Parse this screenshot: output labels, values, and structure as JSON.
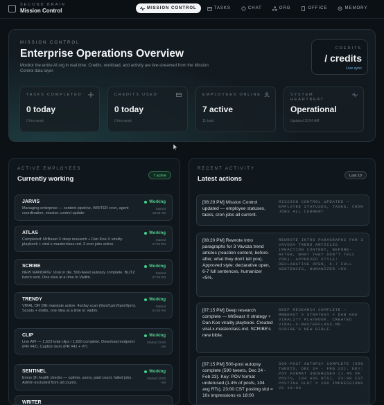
{
  "brand": {
    "sub": "SECOND BRAIN",
    "name": "Mission Control"
  },
  "nav": [
    {
      "label": "MISSION CONTROL",
      "icon": "pulse-icon",
      "active": true
    },
    {
      "label": "TASKS",
      "icon": "calendar-icon",
      "active": false
    },
    {
      "label": "CHAT",
      "icon": "chat-icon",
      "active": false
    },
    {
      "label": "ORG",
      "icon": "org-icon",
      "active": false
    },
    {
      "label": "OFFICE",
      "icon": "building-icon",
      "active": false
    },
    {
      "label": "MEMORY",
      "icon": "memory-icon",
      "active": false
    }
  ],
  "hero": {
    "subtitle": "MISSION CONTROL",
    "title": "Enterprise Operations Overview",
    "description": "Monitor the entire AI org in real time. Credits, workload, and activity are live-streamed from the Mission Control data layer.",
    "credits": {
      "label": "CREDITS",
      "value": "/ credits",
      "sync": "Live sync"
    },
    "stats": [
      {
        "label": "TASKS COMPLETED",
        "value": "0 today",
        "note": "0 this week",
        "icon": "sparkle-icon"
      },
      {
        "label": "CREDITS USED",
        "value": "0 today",
        "note": "0 this week",
        "icon": "card-icon"
      },
      {
        "label": "EMPLOYEES ONLINE",
        "value": "7 active",
        "note": "11 total",
        "icon": "users-icon"
      },
      {
        "label": "SYSTEM HEARTBEAT",
        "value": "Operational",
        "note": "Updated 10:54 AM",
        "icon": "heartbeat-icon"
      }
    ]
  },
  "employees": {
    "subtitle": "ACTIVE EMPLOYEES",
    "title": "Currently working",
    "badge": "7 active",
    "items": [
      {
        "name": "JARVIS",
        "desc": "Managing enterprise — content pipeline, WRITER cron, agent coordination, mission control update",
        "status": "Working",
        "meta1": "Started",
        "meta2": "08:05 AM"
      },
      {
        "name": "ATLAS",
        "desc": "Completed: MrBeast X deep research + Dan Koe X virality playbook + viral-x-masterclass.md. 3 cron jobs active.",
        "status": "Working",
        "meta1": "Started",
        "meta2": "07:00 PM"
      },
      {
        "name": "SCRIBE",
        "desc": "NEW MANDATE: Viral or die. 500-tweet autopsy complete. BLITZ batch sent. One idea at a time to Vadim.",
        "status": "Working",
        "meta1": "Started",
        "meta2": "07:00 PM"
      },
      {
        "name": "TRENDY",
        "desc": "VIRAL OR DIE mandate active. 4x/day scan (9am/1pm/5pm/9pm). Scouts + drafts, one idea at a time to Vadim.",
        "status": "Working",
        "meta1": "Started",
        "meta2": "04:00 PM"
      },
      {
        "name": "CLIP",
        "desc": "Live API — 1,623 total clips / 1,620 complete. Download endpoint (PR #42). Caption burn (PR #41 + #7)",
        "status": "Working",
        "meta1": "Started 12:00",
        "meta2": "AM"
      },
      {
        "name": "SENTINEL",
        "desc": "Every 2h health checks — uptime, users, paid count, failed jobs. Admin excluded from all counts.",
        "status": "Working",
        "meta1": "Started 12:00",
        "meta2": "AM"
      },
      {
        "name": "WRITER",
        "desc": "",
        "status": "",
        "meta1": "",
        "meta2": ""
      }
    ]
  },
  "activity": {
    "subtitle": "RECENT ACTIVITY",
    "title": "Latest actions",
    "badge": "Last 10",
    "items": [
      {
        "text": "[08:29 PM] Mission Control updated — employee statuses, tasks, cron jobs all current.",
        "mono": "MISSION CONTROL UPDATED — EMPLOYEE STATUSES, TASKS, CRON JOBS ALL CURRENT"
      },
      {
        "text": "[08:20 PM] Rewrote intro paragraphs for 3 Vavoza trend articles (reaction content, before-after, what they don't tell you). Approved style: declarative open, 6-7 full sentences, humanizer <5%.",
        "mono": "REWROTE INTRO PARAGRAPHS FOR 3 VAVOZA TREND ARTICLES (REACTION CONTENT, BEFORE-AFTER, WHAT THEY DON'T TELL YOU). APPROVED STYLE: DECLARATIVE OPEN, 6-7 FULL SENTENCES, HUMANIZER <5%"
      },
      {
        "text": "[07:15 PM] Deep research complete — MrBeast X strategy + Dan Koe virality playbook. Created viral-x-masterclass.md. SCRIBE's new bible.",
        "mono": "DEEP RESEARCH COMPLETE — MRBEAST X STRATEGY + DAN KOE VIRALITY PLAYBOOK. CREATED VIRAL-X-MASTERCLASS.MD. SCRIBE'S NEW BIBLE."
      },
      {
        "text": "[07:15 PM] 500-post autopsy complete (590 tweets, Dec 24 - Feb 23). Key: POV format underused (1.4% of posts, 104 avg RTs), 23:00 CST posting slot = 10x impressions vs 18:00",
        "mono": "500-POST AUTOPSY COMPLETE (590 TWEETS, DEC 24 - FEB 23). KEY: POV FORMAT UNDERUSED (1.4% OF POSTS, 104 AVG RTS), 23:00 CST POSTING SLOT = 10X IMPRESSIONS VS 18:00"
      }
    ]
  },
  "colors": {
    "accent_green": "#4fd08c",
    "accent_blue": "#6fb3e6",
    "background": "#0c1116"
  }
}
